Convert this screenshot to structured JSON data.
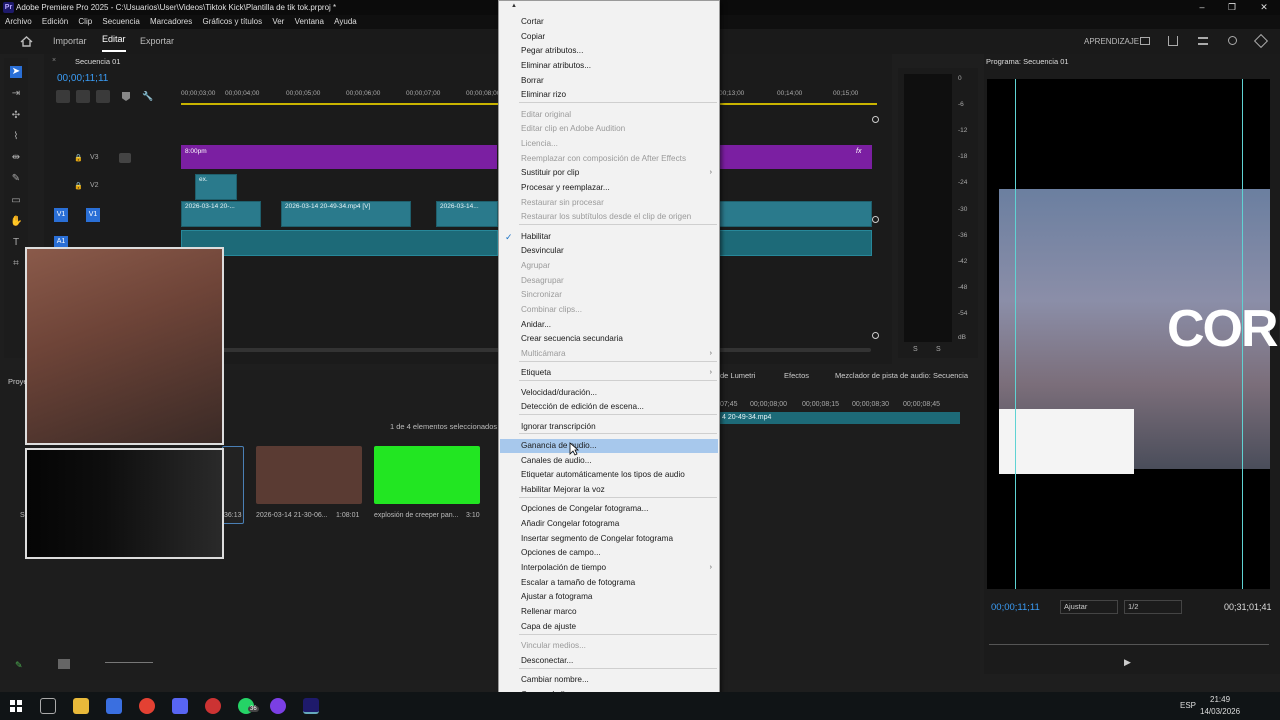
{
  "window": {
    "title": "Adobe Premiere Pro 2025 - C:\\Usuarios\\User\\Videos\\Tiktok Kick\\Plantilla de tik tok.prproj *",
    "app_badge": "Pr",
    "minimize": "–",
    "restore": "❐",
    "close": "✕"
  },
  "menubar": [
    "Archivo",
    "Edición",
    "Clip",
    "Secuencia",
    "Marcadores",
    "Gráficos y títulos",
    "Ver",
    "Ventana",
    "Ayuda"
  ],
  "workspaces": {
    "home_icon": "home-icon",
    "tabs": [
      "Importar",
      "Editar",
      "Exportar"
    ],
    "active": "Editar",
    "learn": "APRENDIZAJE"
  },
  "timeline": {
    "tab": "Secuencia 01",
    "timecode": "00;00;11;11",
    "ruler": [
      "00;00;03;00",
      "00;00;04;00",
      "00;00;05;00",
      "00;00;06;00",
      "00;00;07;00",
      "00;00;08;00",
      "00;00;"
    ],
    "ruler_right": [
      "00;13;00",
      "00;14;00",
      "00;15;00",
      "00;00;"
    ],
    "tracks": [
      "V3",
      "V2",
      "V1",
      "A1"
    ],
    "clips": {
      "v3_label": "8:00pm",
      "v2_label": "ex.",
      "v1_a": "2026-03-14 20-...",
      "v1_b": "2026-03-14 20-49-34.mp4 [V]",
      "v1_c": "2026-03-14...",
      "fx": "fx"
    }
  },
  "meters": {
    "scale": [
      "0",
      "-6",
      "-12",
      "-18",
      "-24",
      "-30",
      "-36",
      "-42",
      "-48",
      "-54",
      "dB"
    ],
    "bottom": [
      "S",
      "S"
    ]
  },
  "program": {
    "tab": "Programa: Secuencia 01",
    "timecode": "00;00;11;11",
    "fit": "Ajustar",
    "res": "1/2",
    "duration": "00;31;01;41",
    "overlay_text": "CORR"
  },
  "project": {
    "tab": "Proyec",
    "selected_count": "1 de 4 elementos seleccionados",
    "items": [
      {
        "name": "Se",
        "dur": "36:13"
      },
      {
        "name": "2026-03-14 21-30-06...",
        "dur": "1:08:01"
      },
      {
        "name": "explosión de creeper pan...",
        "dur": "3:10"
      }
    ]
  },
  "source": {
    "tabs": [
      "de Lumetri",
      "Efectos",
      "Mezclador de pista de audio: Secuencia"
    ],
    "times": [
      "07;45",
      "00;00;08;00",
      "00;00;08;15",
      "00;00;08;30",
      "00;00;08;45"
    ],
    "clip": "4 20-49-34.mp4"
  },
  "context_menu": {
    "items": [
      {
        "label": "Cortar",
        "disabled": false
      },
      {
        "label": "Copiar",
        "disabled": false
      },
      {
        "label": "Pegar atributos...",
        "disabled": false
      },
      {
        "label": "Eliminar atributos...",
        "disabled": false
      },
      {
        "label": "Borrar",
        "disabled": false
      },
      {
        "label": "Eliminar rizo",
        "disabled": false
      },
      {
        "label": "Editar original",
        "disabled": true
      },
      {
        "label": "Editar clip en Adobe Audition",
        "disabled": true
      },
      {
        "label": "Licencia...",
        "disabled": true
      },
      {
        "label": "Reemplazar con composición de After Effects",
        "disabled": true
      },
      {
        "label": "Sustituir por clip",
        "disabled": false,
        "submenu": true
      },
      {
        "label": "Procesar y reemplazar...",
        "disabled": false
      },
      {
        "label": "Restaurar sin procesar",
        "disabled": true
      },
      {
        "label": "Restaurar los subtítulos desde el clip de origen",
        "disabled": true
      },
      {
        "label": "Habilitar",
        "disabled": false,
        "checked": true
      },
      {
        "label": "Desvincular",
        "disabled": false
      },
      {
        "label": "Agrupar",
        "disabled": true
      },
      {
        "label": "Desagrupar",
        "disabled": true
      },
      {
        "label": "Sincronizar",
        "disabled": true
      },
      {
        "label": "Combinar clips...",
        "disabled": true
      },
      {
        "label": "Anidar...",
        "disabled": false
      },
      {
        "label": "Crear secuencia secundaria",
        "disabled": false
      },
      {
        "label": "Multicámara",
        "disabled": true,
        "submenu": true
      },
      {
        "label": "Etiqueta",
        "disabled": false,
        "submenu": true
      },
      {
        "label": "Velocidad/duración...",
        "disabled": false
      },
      {
        "label": "Detección de edición de escena...",
        "disabled": false
      },
      {
        "label": "Ignorar transcripción",
        "disabled": false
      },
      {
        "label": "Ganancia de audio...",
        "disabled": false,
        "highlighted": true
      },
      {
        "label": "Canales de audio...",
        "disabled": false
      },
      {
        "label": "Etiquetar automáticamente los tipos de audio",
        "disabled": false
      },
      {
        "label": "Habilitar Mejorar la voz",
        "disabled": false
      },
      {
        "label": "Opciones de Congelar fotograma...",
        "disabled": false
      },
      {
        "label": "Añadir Congelar fotograma",
        "disabled": false
      },
      {
        "label": "Insertar segmento de Congelar fotograma",
        "disabled": false
      },
      {
        "label": "Opciones de campo...",
        "disabled": false
      },
      {
        "label": "Interpolación de tiempo",
        "disabled": false,
        "submenu": true
      },
      {
        "label": "Escalar a tamaño de fotograma",
        "disabled": false
      },
      {
        "label": "Ajustar a fotograma",
        "disabled": false
      },
      {
        "label": "Rellenar marco",
        "disabled": false
      },
      {
        "label": "Capa de ajuste",
        "disabled": false
      },
      {
        "label": "Vincular medios...",
        "disabled": true
      },
      {
        "label": "Desconectar...",
        "disabled": false
      },
      {
        "label": "Cambiar nombre...",
        "disabled": false
      },
      {
        "label": "Crear subclip...",
        "disabled": false
      }
    ],
    "check_mark": "✓",
    "submenu_arrow": "›",
    "scroll_up": "▲",
    "scroll_down": "▼"
  },
  "taskbar": {
    "lang": "ESP",
    "time": "21:49",
    "date": "14/03/2026",
    "badge": "36"
  }
}
